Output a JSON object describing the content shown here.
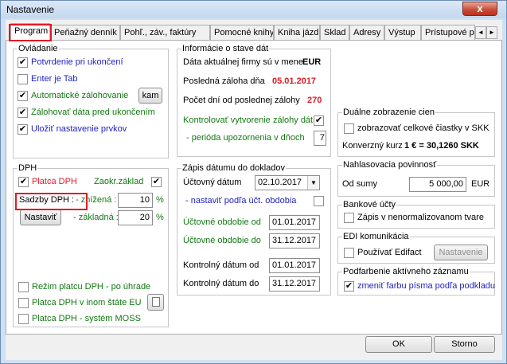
{
  "window": {
    "title": "Nastavenie",
    "close": "x"
  },
  "tabs": [
    "Program",
    "Peňažný denník",
    "Pohľ., záv., faktúry",
    "Pomocné knihy",
    "Kniha jázd",
    "Sklad",
    "Adresy",
    "Výstup",
    "Prístupové pr"
  ],
  "tab_scroll": {
    "left": "◄",
    "right": "►"
  },
  "ovladanie": {
    "legend": "Ovládanie",
    "items": [
      "Potvrdenie pri ukončení",
      "Enter je Tab",
      "Automatické zálohovanie",
      "Zálohovať dáta pred ukončením",
      "Uložiť nastavenie prvkov"
    ],
    "checked": [
      true,
      false,
      true,
      true,
      true
    ],
    "kam_button": "kam"
  },
  "info": {
    "legend": "Informácie o stave dát",
    "firm_label": "Dáta aktuálnej firmy sú v mene",
    "firm_value": "EUR",
    "backup_label": "Posledná záloha dňa",
    "backup_value": "05.01.2017",
    "days_label": "Počet dní od poslednej zálohy",
    "days_value": "270",
    "control_label": "Kontrolovať vytvorenie zálohy dát",
    "control_checked": true,
    "period_label": "- perióda upozornenia v dňoch",
    "period_value": "7"
  },
  "dph": {
    "legend": "DPH",
    "platca_label": "Platca DPH",
    "platca_checked": true,
    "zaokr_label": "Zaokr.základ",
    "zaokr_checked": true,
    "sadzby_label": "Sadzby DPH :",
    "reduced_label": "- znížená :",
    "reduced_value": "10",
    "basic_label": "- základná :",
    "basic_value": "20",
    "percent": "%",
    "nastavit_button": "Nastaviť",
    "rezim_label": "Režim platcu DPH - po úhrade",
    "inom_label": "Platca DPH v inom štáte EU",
    "moss_label": "Platca DPH - systém MOSS"
  },
  "zapis": {
    "legend": "Zápis dátumu do dokladov",
    "uctovny_label": "Účtovný dátum",
    "uctovny_value": "02.10.2017",
    "nastavit_obd_label": "- nastaviť podľa účt. obdobia",
    "obdobie_od_label": "Účtovné obdobie od",
    "obdobie_od_value": "01.01.2017",
    "obdobie_do_label": "Účtovné obdobie do",
    "obdobie_do_value": "31.12.2017",
    "kontrolny_od_label": "Kontrolný dátum od",
    "kontrolny_od_value": "01.01.2017",
    "kontrolny_do_label": "Kontrolný dátum do",
    "kontrolny_do_value": "31.12.2017"
  },
  "dualne": {
    "legend": "Duálne zobrazenie cien",
    "zobrazovat_label": "zobrazovať celkové čiastky v SKK",
    "kurz_label": "Konverzný kurz",
    "kurz_value": "1 € = 30,1260 SKK"
  },
  "hlasovacia": {
    "legend": "Nahlasovacia povinnosť",
    "od_sumy_label": "Od sumy",
    "od_sumy_value": "5 000,00",
    "currency": "EUR"
  },
  "bankove": {
    "legend": "Bankové účty",
    "zapis_label": "Zápis v nenormalizovanom tvare"
  },
  "edi": {
    "legend": "EDI komunikácia",
    "edifact_label": "Používať Edifact",
    "nastavenie_button": "Nastavenie"
  },
  "podfarbenie": {
    "legend": "Podfarbenie aktívneho záznamu",
    "zmenit_label": "zmeniť farbu písma podľa podkladu",
    "zmenit_checked": true
  },
  "footer": {
    "ok": "OK",
    "storno": "Storno"
  },
  "colors": {
    "accent_red": "#e01b24",
    "link_blue": "#1f1fbf",
    "label_green": "#127812"
  }
}
